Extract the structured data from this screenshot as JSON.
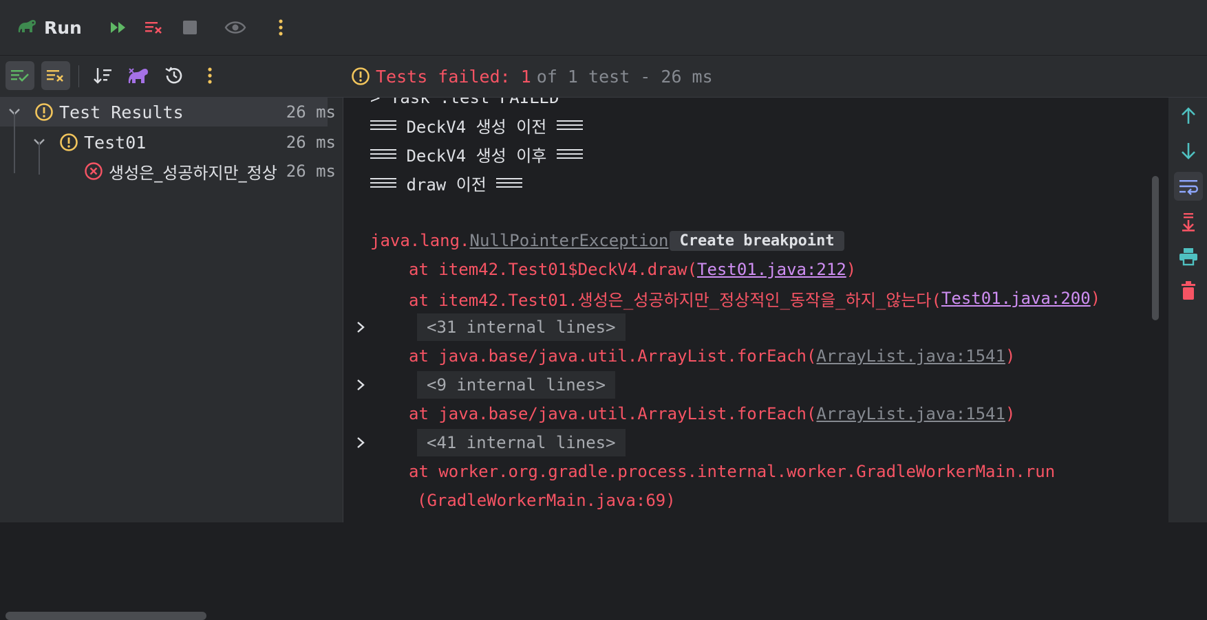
{
  "run_bar": {
    "title": "Run",
    "buttons": [
      "rerun-failed",
      "stop-and-rerun",
      "stop",
      "show",
      "more"
    ]
  },
  "test_toolbar": {
    "status_failed": "Tests failed: 1",
    "status_rest": "of 1 test - 26 ms"
  },
  "tree": {
    "root": {
      "label": "Test Results",
      "time": "26 ms"
    },
    "class": {
      "label": "Test01",
      "time": "26 ms"
    },
    "method": {
      "label": "생성은_성공하지만_정상",
      "time": "26 ms"
    }
  },
  "console": {
    "cut_top": "> Task :test FAILED",
    "lines": [
      {
        "pre": "DeckV4 생성 이전"
      },
      {
        "pre": "DeckV4 생성 이후"
      },
      {
        "pre": "draw 이전"
      }
    ],
    "exception": {
      "prefix": "java.lang.",
      "name": "NullPointerException",
      "breakpoint": "Create breakpoint"
    },
    "stack": {
      "l1_pre": "at item42.Test01$DeckV4.draw(",
      "l1_link": "Test01.java:212",
      "l1_post": ")",
      "l2_pre": "at item42.Test01.생성은_성공하지만_정상적인_동작을_하지_않는다(",
      "l2_link": "Test01.java:200",
      "l2_post": ")",
      "internal1": "<31 internal lines>",
      "l3_pre": "at java.base/java.util.ArrayList.forEach(",
      "l3_link": "ArrayList.java:1541",
      "l3_post": ")",
      "internal2": "<9 internal lines>",
      "l4_pre": "at java.base/java.util.ArrayList.forEach(",
      "l4_link": "ArrayList.java:1541",
      "l4_post": ")",
      "internal3": "<41 internal lines>",
      "l5": "at worker.org.gradle.process.internal.worker.GradleWorkerMain.run",
      "l6": "(GradleWorkerMain.java:69)"
    }
  },
  "colors": {
    "error": "#f75464",
    "link": "#cf8ef3",
    "warning": "#f2c55c",
    "success": "#5fb865"
  }
}
